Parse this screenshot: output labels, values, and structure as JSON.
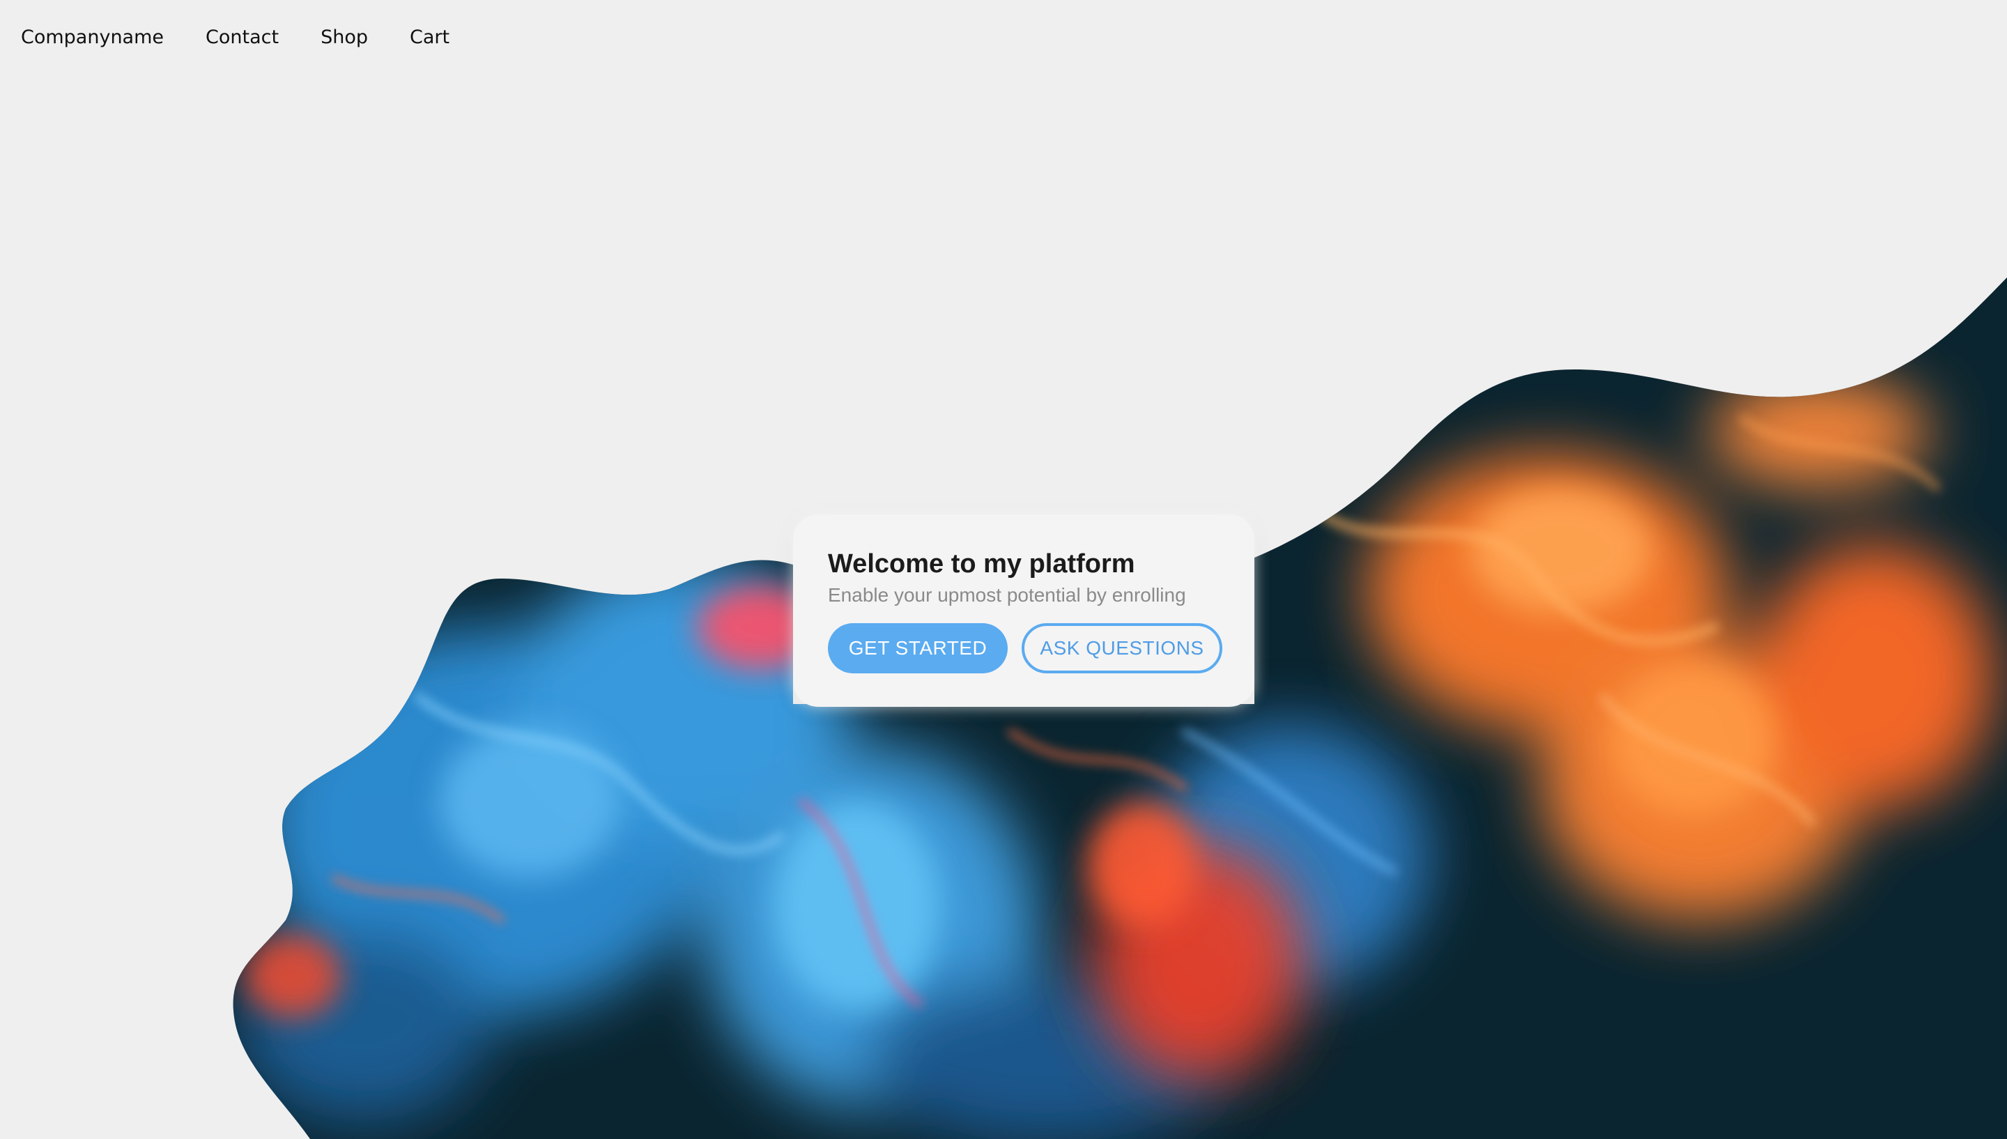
{
  "nav": {
    "brand": "Companyname",
    "links": [
      "Contact",
      "Shop",
      "Cart"
    ]
  },
  "hero": {
    "title": "Welcome to my platform",
    "subtitle": "Enable your upmost potential by enrolling",
    "primary_button": "GET STARTED",
    "secondary_button": "ASK QUESTIONS"
  },
  "colors": {
    "background": "#efefef",
    "accent": "#5aabf0",
    "art_dark": "#0b2530",
    "art_blue": "#3a9be0",
    "art_orange": "#ff7a2a",
    "art_red": "#e8402a"
  }
}
